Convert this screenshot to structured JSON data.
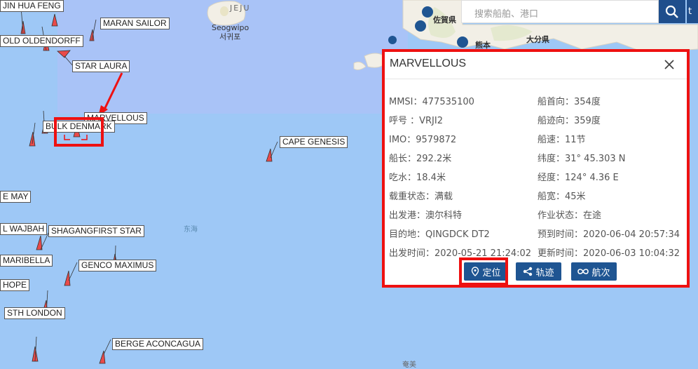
{
  "search": {
    "placeholder": "搜索船舶、港口",
    "extra_text": "t"
  },
  "map": {
    "place_labels": [
      "JEJU",
      "Seogwipo",
      "서귀포",
      "佐賀県",
      "大分県",
      "熊本",
      "东海",
      "奄美"
    ],
    "ship_labels": [
      "JIN HUA FENG",
      "MARAN SAILOR",
      "OLD OLDENDORFF",
      "STAR LAURA",
      "MARVELLOUS",
      "BULK DENMARK",
      "CAPE GENESIS",
      "E MAY",
      "L WAJBAH",
      "SHAGANGFIRST STAR",
      "MARIBELLA",
      "GENCO MAXIMUS",
      "HOPE",
      "STH LONDON",
      "BERGE ACONCAGUA"
    ]
  },
  "popup": {
    "title": "MARVELLOUS",
    "left_items": [
      "MMSI：477535100",
      "呼号 ：VRJI2",
      "IMO：9579872",
      "船长：292.2米",
      "吃水：18.4米",
      "载重状态：满载",
      "出发港：澳尔科特",
      "目的地：QINGDCK DT2",
      "出发时间：2020-05-21 21:24:02"
    ],
    "right_items": [
      "船首向：354度",
      "船迹向：359度",
      "船速：11节",
      "纬度：31° 45.303 N",
      "经度：124° 4.36 E",
      "船宽：45米",
      "作业状态：在途",
      "预到时间：2020-06-04 20:57:34",
      "更新时间：2020-06-03 10:04:32"
    ],
    "buttons": {
      "locate": "定位",
      "track": "轨迹",
      "voyage": "航次"
    }
  },
  "colors": {
    "accent": "#1f5592",
    "highlight": "#e11111",
    "sea": "#9ec8f6",
    "land": "#f2efe6"
  }
}
